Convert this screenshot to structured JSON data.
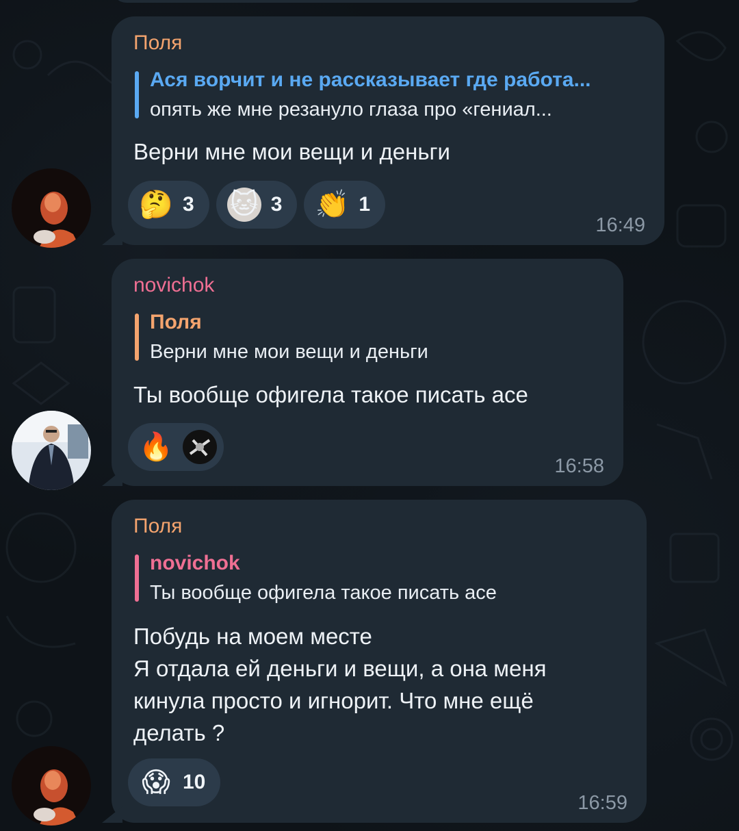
{
  "messages": [
    {
      "sender": "Поля",
      "reply": {
        "name": "Ася ворчит и не рассказывает где работа...",
        "text": "опять же мне резануло глаза про «гениал..."
      },
      "text": "Верни мне мои вещи и деньги",
      "reactions": [
        {
          "icon": "thinking-face",
          "glyph": "🤔",
          "count": "3"
        },
        {
          "icon": "cat-sticker",
          "glyph": "🐱",
          "count": "3"
        },
        {
          "icon": "clapping-hands",
          "glyph": "👏",
          "count": "1"
        }
      ],
      "time": "16:49"
    },
    {
      "sender": "novichok",
      "reply": {
        "name": "Поля",
        "text": "Верни мне мои вещи и деньги"
      },
      "text": "Ты вообще офигела такое писать асе",
      "reactions": [
        {
          "icon": "fire",
          "glyph": "🔥",
          "count": ""
        },
        {
          "icon": "custom-sticker",
          "glyph": "",
          "count": ""
        }
      ],
      "time": "16:58"
    },
    {
      "sender": "Поля",
      "reply": {
        "name": "novichok",
        "text": "Ты вообще офигела такое писать асе"
      },
      "text_lines": [
        "Побудь на моем месте",
        "Я отдала ей деньги и вещи, а она меня",
        "кинула просто и игнорит. Что мне ещё",
        "делать ?"
      ],
      "reactions": [
        {
          "icon": "screaming-face",
          "glyph": "😱",
          "count": "10"
        }
      ],
      "time": "16:59"
    }
  ],
  "colors": {
    "bubble": "#1f2a34",
    "polya_name": "#f4a46e",
    "novichok_name": "#ef6f93",
    "reply_link": "#5aa9f2",
    "time": "#8c99a6",
    "reaction_bg": "#2c3b4a"
  }
}
